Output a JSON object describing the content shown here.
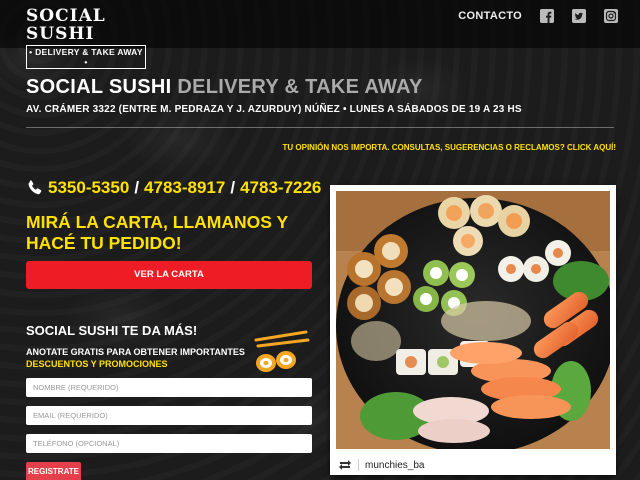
{
  "brand": {
    "name": "SOCIAL SUSHI",
    "tagline": "• DELIVERY & TAKE AWAY •"
  },
  "nav": {
    "contact_label": "CONTACTO",
    "social": [
      "facebook-icon",
      "twitter-icon",
      "instagram-icon"
    ]
  },
  "hero": {
    "title_main": "SOCIAL SUSHI",
    "title_sub": "DELIVERY & TAKE AWAY",
    "address": "AV. CRÁMER 3322 (ENTRE M. PEDRAZA Y J. AZURDUY) NÚÑEZ • LUNES A SÁBADOS DE 19 A 23 HS",
    "opinion_link": "TU OPINIÓN NOS IMPORTA. CONSULTAS, SUGERENCIAS O RECLAMOS? CLICK AQUÍ!"
  },
  "phones": {
    "numbers": [
      "5350-5350",
      "4783-8917",
      "4783-7226"
    ],
    "separator": "/"
  },
  "cta": {
    "text": "MIRÁ LA CARTA, LLAMANOS Y HACÉ TU PEDIDO!",
    "button_label": "VER LA CARTA"
  },
  "signup": {
    "title": "SOCIAL SUSHI TE DA MÁS!",
    "desc_prefix": "ANOTATE GRATIS PARA OBTENER IMPORTANTES",
    "desc_highlight": "DESCUENTOS Y PROMOCIONES",
    "name_placeholder": "NOMBRE (REQUERIDO)",
    "email_placeholder": "EMAIL (REQUERIDO)",
    "phone_placeholder": "TELÉFONO (OPCIONAL)",
    "submit_label": "REGISTRATE"
  },
  "photo": {
    "credit": "munchies_ba"
  },
  "colors": {
    "accent_yellow": "#ffe100",
    "button_red": "#ee1c24",
    "background": "#1c1c1c"
  }
}
